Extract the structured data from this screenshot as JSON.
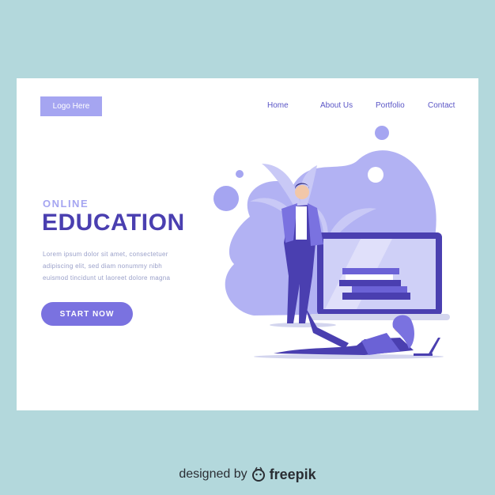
{
  "header": {
    "logo_label": "Logo Here",
    "nav": [
      "Home",
      "About Us",
      "Portfolio",
      "Contact"
    ]
  },
  "hero": {
    "eyebrow": "ONLINE",
    "title": "EDUCATION",
    "body_lines": [
      "Lorem ipsum dolor sit amet, consectetuer",
      "adipiscing elit, sed diam nonummy nibh",
      "euismod tincidunt ut laoreet dolore magna"
    ],
    "cta_label": "START NOW"
  },
  "illustration": {
    "icons": [
      "teacher-figure-icon",
      "laptop-icon",
      "books-icon",
      "student-figure-icon",
      "small-laptop-icon",
      "palm-leaf-icon"
    ]
  },
  "footer": {
    "designed_by": "designed by",
    "brand": "freepik"
  },
  "colors": {
    "background": "#b3d8dc",
    "accent": "#a5a5f1",
    "primary": "#4a3fb0",
    "button": "#7a72e0"
  }
}
